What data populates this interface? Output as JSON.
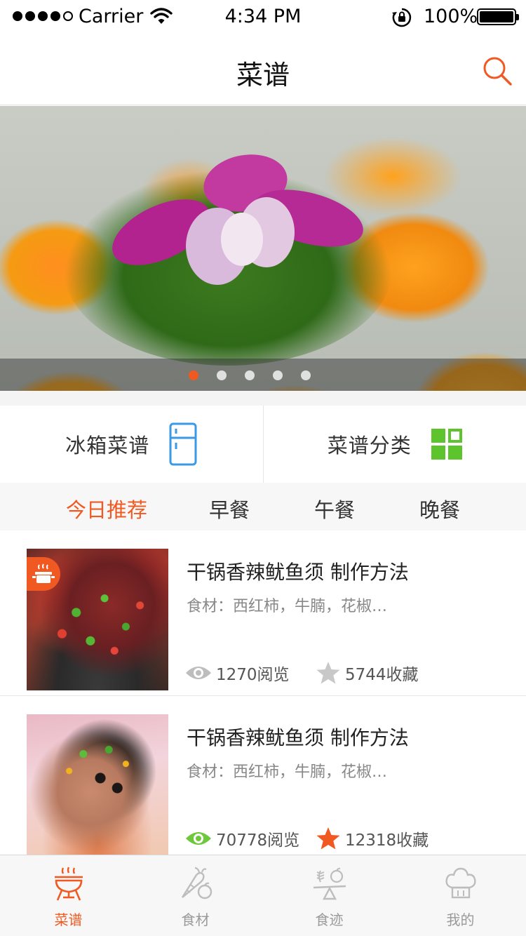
{
  "status_bar": {
    "carrier": "Carrier",
    "time": "4:34 PM",
    "battery": "100%",
    "signal_dots": 5,
    "signal_filled": 4
  },
  "nav": {
    "title": "菜谱",
    "search_icon": "search-icon"
  },
  "banner": {
    "slides": 5,
    "active_slide": 1,
    "image": "banner-food-photo"
  },
  "quick_entries": [
    {
      "label": "冰箱菜谱",
      "icon": "fridge-icon",
      "color": "#3a9ae6"
    },
    {
      "label": "菜谱分类",
      "icon": "grid-icon",
      "color": "#5ec42e"
    }
  ],
  "meal_tabs": [
    {
      "label": "今日推荐",
      "active": true
    },
    {
      "label": "早餐",
      "active": false
    },
    {
      "label": "午餐",
      "active": false
    },
    {
      "label": "晚餐",
      "active": false
    }
  ],
  "recipes": [
    {
      "title": "干锅香辣鱿鱼须 制作方法",
      "ingredients": "食材：西红柿，牛腩，花椒…",
      "views": "1270阅览",
      "favorites": "5744收藏",
      "viewed": false,
      "favorited": false,
      "badge": "pot-icon"
    },
    {
      "title": "干锅香辣鱿鱼须 制作方法",
      "ingredients": "食材：西红柿，牛腩，花椒…",
      "views": "70778阅览",
      "favorites": "12318收藏",
      "viewed": true,
      "favorited": true
    }
  ],
  "tab_bar": [
    {
      "label": "菜谱",
      "icon": "grill-icon",
      "active": true
    },
    {
      "label": "食材",
      "icon": "vegetables-icon",
      "active": false
    },
    {
      "label": "食迹",
      "icon": "scale-icon",
      "active": false
    },
    {
      "label": "我的",
      "icon": "chef-hat-icon",
      "active": false
    }
  ],
  "colors": {
    "accent": "#f05a22",
    "fridge_blue": "#3a9ae6",
    "grid_green": "#5ec42e",
    "view_green": "#6dc93b",
    "inactive_gray": "#bdbdbd"
  }
}
